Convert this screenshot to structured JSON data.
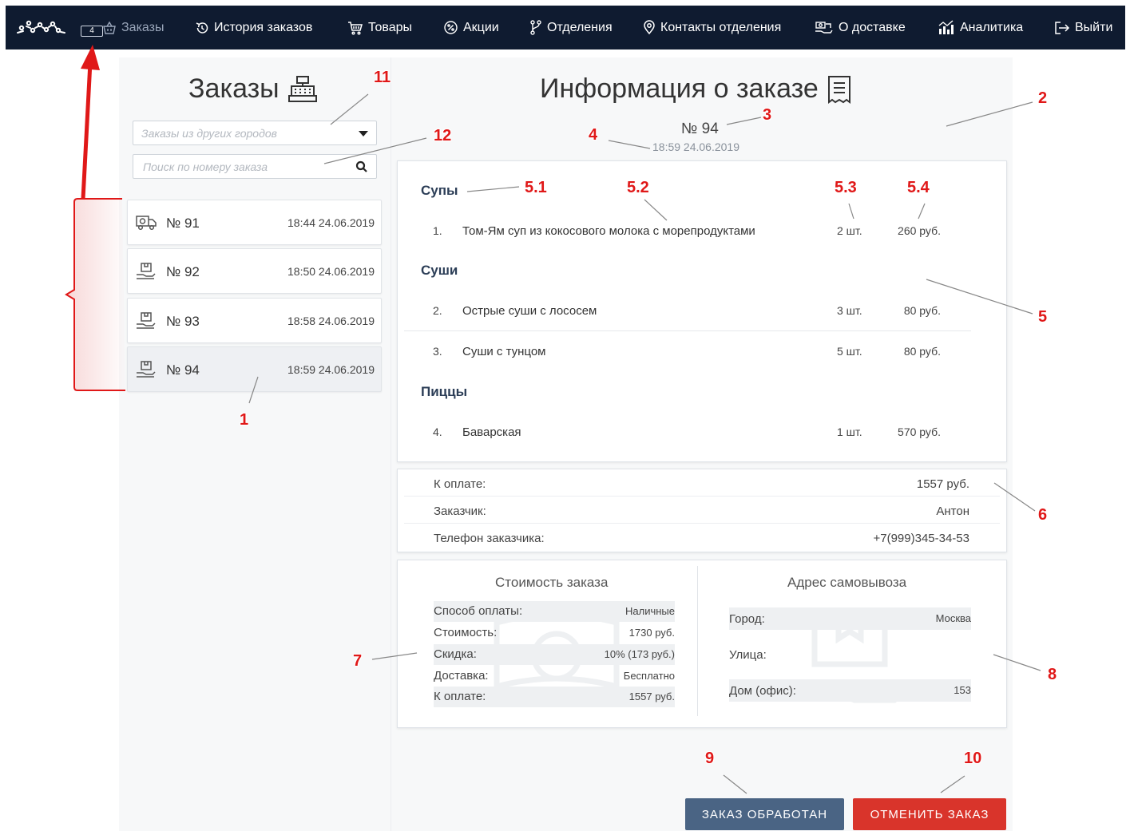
{
  "nav": {
    "items": [
      {
        "label": "Заказы",
        "icon": "basket-icon"
      },
      {
        "label": "История заказов",
        "icon": "history-icon"
      },
      {
        "label": "Товары",
        "icon": "cart-icon"
      },
      {
        "label": "Акции",
        "icon": "discount-icon"
      },
      {
        "label": "Отделения",
        "icon": "branches-icon"
      },
      {
        "label": "Контакты отделения",
        "icon": "location-pin-icon"
      },
      {
        "label": "О доставке",
        "icon": "delivery-money-icon"
      },
      {
        "label": "Аналитика",
        "icon": "analytics-icon"
      },
      {
        "label": "Выйти",
        "icon": "logout-icon"
      }
    ],
    "cart_badge": "4",
    "colors": {
      "background": "#0f1b30",
      "active_text": "#9aa6ba"
    }
  },
  "orders_panel": {
    "title": "Заказы",
    "city_select": {
      "placeholder": "Заказы из других городов"
    },
    "search": {
      "placeholder": "Поиск по номеру заказа"
    },
    "orders": [
      {
        "number": "№ 91",
        "time": "18:44 24.06.2019",
        "icon": "delivery-truck-icon"
      },
      {
        "number": "№ 92",
        "time": "18:50 24.06.2019",
        "icon": "pickup-box-icon"
      },
      {
        "number": "№ 93",
        "time": "18:58 24.06.2019",
        "icon": "pickup-box-icon"
      },
      {
        "number": "№ 94",
        "time": "18:59 24.06.2019",
        "icon": "pickup-box-icon"
      }
    ]
  },
  "order_info": {
    "title": "Информация о заказе",
    "number": "№ 94",
    "time": "18:59 24.06.2019",
    "categories": [
      {
        "name": "Супы",
        "items": [
          {
            "n": "1.",
            "name": "Том-Ям суп из кокосового молока с морепродуктами",
            "qty": "2 шт.",
            "price": "260 руб."
          }
        ]
      },
      {
        "name": "Суши",
        "items": [
          {
            "n": "2.",
            "name": "Острые суши с лососем",
            "qty": "3 шт.",
            "price": "80 руб."
          },
          {
            "n": "3.",
            "name": "Суши с тунцом",
            "qty": "5 шт.",
            "price": "80 руб."
          }
        ]
      },
      {
        "name": "Пиццы",
        "items": [
          {
            "n": "4.",
            "name": "Баварская",
            "qty": "1 шт.",
            "price": "570 руб."
          }
        ]
      }
    ],
    "payment": [
      {
        "label": "К оплате:",
        "value": "1557 руб."
      },
      {
        "label": "Заказчик:",
        "value": "Антон"
      },
      {
        "label": "Телефон заказчика:",
        "value": "+7(999)345-34-53"
      }
    ],
    "cost": {
      "title": "Стоимость заказа",
      "rows": [
        {
          "label": "Способ оплаты:",
          "value": "Наличные"
        },
        {
          "label": "Стоимость:",
          "value": "1730 руб."
        },
        {
          "label": "Скидка:",
          "value": "10% (173 руб.)"
        },
        {
          "label": "Доставка:",
          "value": "Бесплатно"
        },
        {
          "label": "К оплате:",
          "value": "1557 руб."
        }
      ]
    },
    "pickup": {
      "title": "Адрес самовывоза",
      "rows": [
        {
          "label": "Город:",
          "value": "Москва"
        },
        {
          "label": "Улица:",
          "value": ""
        },
        {
          "label": "Дом (офис):",
          "value": "153"
        }
      ]
    },
    "buttons": {
      "processed": "ЗАКАЗ ОБРАБОТАН",
      "cancel": "ОТМЕНИТЬ ЗАКАЗ"
    },
    "colors": {
      "processed": "#4a6484",
      "cancel": "#d9342b"
    }
  },
  "annotations": [
    "1",
    "2",
    "3",
    "4",
    "5.1",
    "5.2",
    "5.3",
    "5.4",
    "5",
    "6",
    "7",
    "8",
    "9",
    "10",
    "11",
    "12"
  ]
}
